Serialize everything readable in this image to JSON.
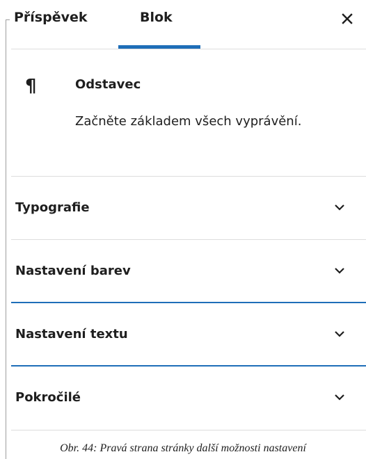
{
  "header": {
    "tabs": [
      {
        "label": "Příspěvek",
        "active": false
      },
      {
        "label": "Blok",
        "active": true
      }
    ],
    "close_icon": "close-icon",
    "accent_color": "#1e6eb8"
  },
  "block": {
    "icon": "pilcrow-icon",
    "title": "Odstavec",
    "description": "Začněte základem všech vyprávění."
  },
  "sections": [
    {
      "label": "Typografie",
      "expanded": false
    },
    {
      "label": "Nastavení barev",
      "expanded": false
    },
    {
      "label": "Nastavení textu",
      "expanded": false
    },
    {
      "label": "Pokročilé",
      "expanded": false
    }
  ],
  "caption": "Obr. 44: Pravá strana stránky další možnosti nastavení"
}
